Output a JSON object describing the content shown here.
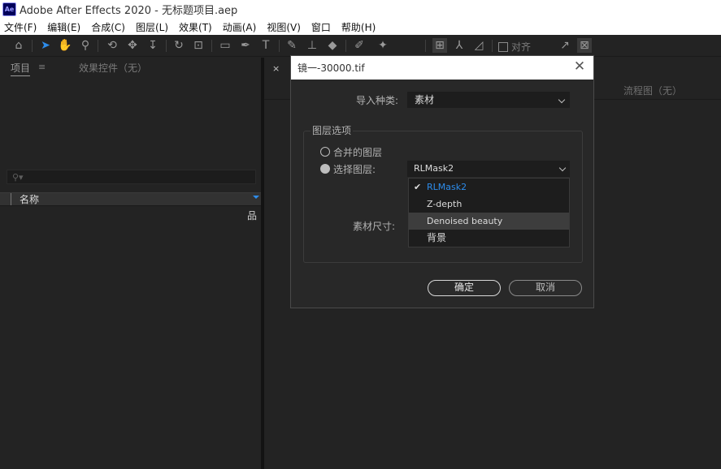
{
  "app": {
    "logo_text": "Ae",
    "window_title": "Adobe After Effects 2020 - 无标题项目.aep"
  },
  "menu": [
    "文件(F)",
    "编辑(E)",
    "合成(C)",
    "图层(L)",
    "效果(T)",
    "动画(A)",
    "视图(V)",
    "窗口",
    "帮助(H)"
  ],
  "toolbar": {
    "snap_label": "对齐"
  },
  "project_panel": {
    "tab_project": "项目",
    "tab_menu_icon": "≡",
    "tab_effects": "效果控件（无）",
    "column_name": "名称"
  },
  "comp_panel": {
    "close_label": "×",
    "flowchart_tab": "流程图（无）"
  },
  "dialog": {
    "title": "镜一-30000.tif",
    "import_kind_label": "导入种类:",
    "import_kind_value": "素材",
    "layer_options_title": "图层选项",
    "merged_layers_label": "合并的图层",
    "choose_layer_label": "选择图层:",
    "selected_layer": "RLMask2",
    "footage_dimensions_label": "素材尺寸:",
    "layer_options": [
      "RLMask2",
      "Z-depth",
      "Denoised beauty",
      "背景"
    ],
    "ok_label": "确定",
    "cancel_label": "取消"
  },
  "colors": {
    "accent": "#2d8ceb",
    "background": "#232323",
    "dialog_bg": "#282828"
  }
}
